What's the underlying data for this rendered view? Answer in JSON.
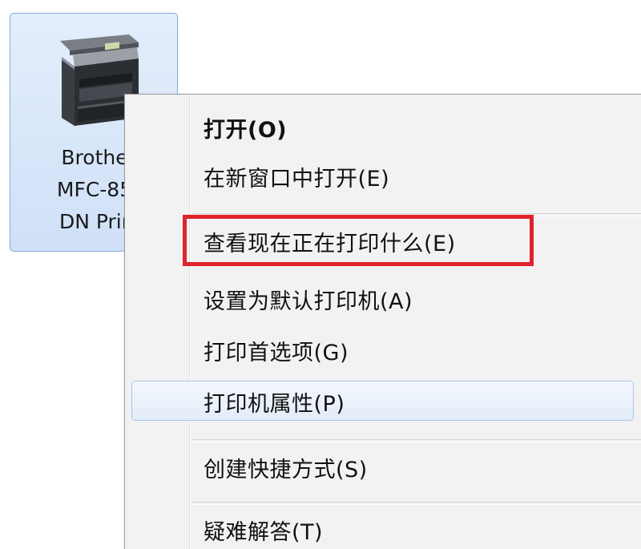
{
  "desktop_icon": {
    "label_lines": [
      "Brothe",
      "MFC-85",
      "DN Prir"
    ],
    "icon": "printer-icon"
  },
  "context_menu": {
    "items": [
      {
        "label": "打开(O)",
        "bold": true
      },
      {
        "label": "在新窗口中打开(E)"
      },
      {
        "label": "查看现在正在打印什么(E)",
        "annotated": true
      },
      {
        "label": "设置为默认打印机(A)"
      },
      {
        "label": "打印首选项(G)"
      },
      {
        "label": "打印机属性(P)",
        "hovered": true
      },
      {
        "label": "创建快捷方式(S)"
      },
      {
        "label": "疑难解答(T)"
      }
    ]
  },
  "colors": {
    "annotation_red": "#e0232c",
    "selection_blue": "#84acdd",
    "menu_background": "#f2f2f2"
  }
}
